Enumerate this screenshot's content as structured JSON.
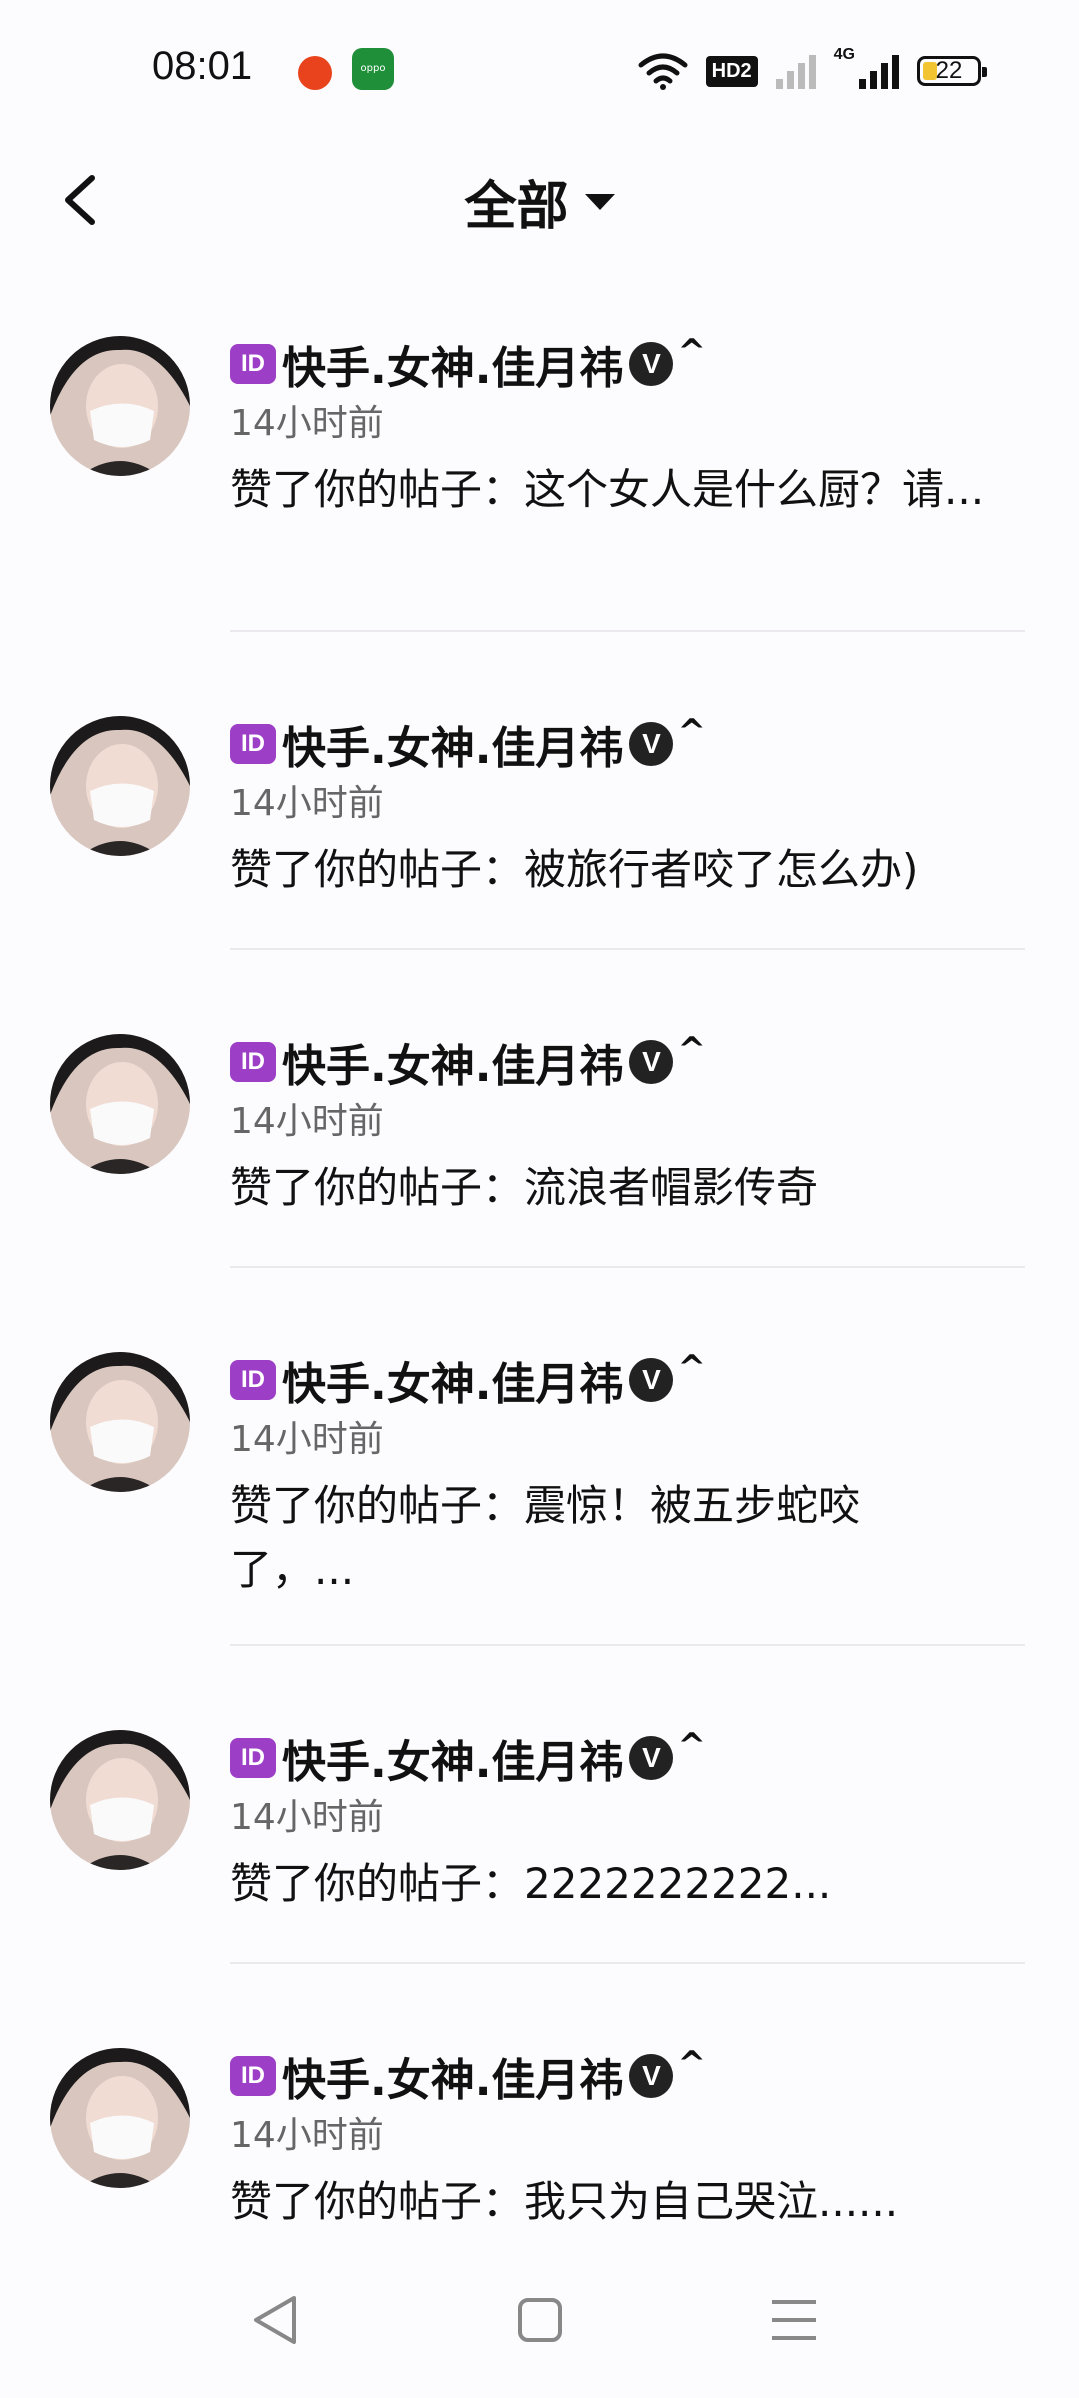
{
  "status_bar": {
    "time": "08:01",
    "app_icon_2_text": "oppo",
    "hd_label": "HD2",
    "network_label": "4G",
    "battery_level": "22"
  },
  "header": {
    "title": "全部"
  },
  "notifications": [
    {
      "name": "快手.女神.佳月祎",
      "id_badge": "ID",
      "verified": "V",
      "suffix": "^",
      "time": "14小时前",
      "content": "赞了你的帖子：这个女人是什么厨？请..."
    },
    {
      "name": "快手.女神.佳月祎",
      "id_badge": "ID",
      "verified": "V",
      "suffix": "^",
      "time": "14小时前",
      "content": "赞了你的帖子：被旅行者咬了怎么办)"
    },
    {
      "name": "快手.女神.佳月祎",
      "id_badge": "ID",
      "verified": "V",
      "suffix": "^",
      "time": "14小时前",
      "content": "赞了你的帖子：流浪者帽影传奇"
    },
    {
      "name": "快手.女神.佳月祎",
      "id_badge": "ID",
      "verified": "V",
      "suffix": "^",
      "time": "14小时前",
      "content": "赞了你的帖子：震惊！被五步蛇咬了，..."
    },
    {
      "name": "快手.女神.佳月祎",
      "id_badge": "ID",
      "verified": "V",
      "suffix": "^",
      "time": "14小时前",
      "content": "赞了你的帖子：2222222222..."
    },
    {
      "name": "快手.女神.佳月祎",
      "id_badge": "ID",
      "verified": "V",
      "suffix": "^",
      "time": "14小时前",
      "content": "赞了你的帖子：我只为自己哭泣......"
    }
  ]
}
